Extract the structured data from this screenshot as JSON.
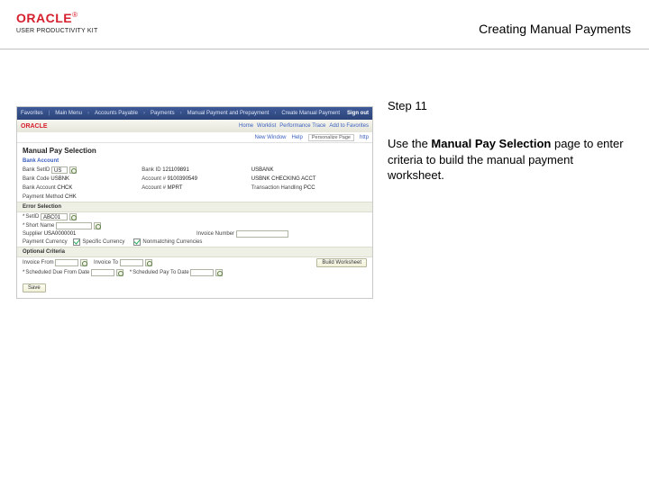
{
  "header": {
    "brand_main": "ORACLE",
    "brand_reg": "®",
    "brand_sub": "USER PRODUCTIVITY KIT",
    "title": "Creating Manual Payments"
  },
  "sidebar": {
    "step_label": "Step 11",
    "instr_pre": "Use the ",
    "instr_bold": "Manual Pay Selection",
    "instr_post": " page to enter criteria to build the manual payment worksheet."
  },
  "app": {
    "topbar": {
      "items": [
        "Favorites",
        "Main Menu",
        "Accounts Payable",
        "Payments",
        "Manual Payment and Prepayment",
        "Create Manual Payment"
      ],
      "signout": "Sign out"
    },
    "subbar": {
      "logo": "ORACLE",
      "links": [
        "Home",
        "Worklist",
        "Performance Trace",
        "Add to Favorites"
      ]
    },
    "userline": {
      "history": "New Window",
      "help": "Help",
      "personalize": "Personalize Page",
      "http": "http"
    },
    "page_title": "Manual Pay Selection",
    "bank_account_head": "Bank Account",
    "bank": {
      "setid_lbl": "Bank SetID",
      "setid_val": "US",
      "code_lbl": "Bank Code",
      "code_val": "USBNK",
      "account_lbl": "Bank Account",
      "account_val": "CHCK",
      "method_lbl": "Payment Method",
      "method_val": "CHK",
      "id_lbl": "Bank ID",
      "id_val": "121109891",
      "accountno_lbl": "Account #",
      "accountno_val": "9100390549",
      "accountnm_lbl": "Account #",
      "accountnm_val": "MPRT",
      "desc1_lbl": "USBANK",
      "desc2_val": "USBNK CHECKING ACCT",
      "trans_lbl": "Transaction Handling",
      "trans_val": "PCC"
    },
    "errsel": {
      "head": "Error Selection",
      "setid_lbl": "SetID",
      "setid_val": "ABC01",
      "short_lbl": "Short Name",
      "supplier_lbl": "Supplier",
      "supplier_val": "USA0000001",
      "invoice_lbl": "Invoice Number",
      "paycur_lbl": "Payment Currency",
      "speccur_lbl": "Specific Currency",
      "nonmatch_lbl": "Nonmatching Currencies"
    },
    "opt": {
      "head": "Optional Criteria",
      "invfrom_lbl": "Invoice From",
      "invto_lbl": "Invoice To",
      "schfrom_lbl": "Scheduled Due From Date",
      "schto_lbl": "Scheduled Pay To Date"
    },
    "buttons": {
      "build": "Build Worksheet",
      "save": "Save"
    }
  }
}
